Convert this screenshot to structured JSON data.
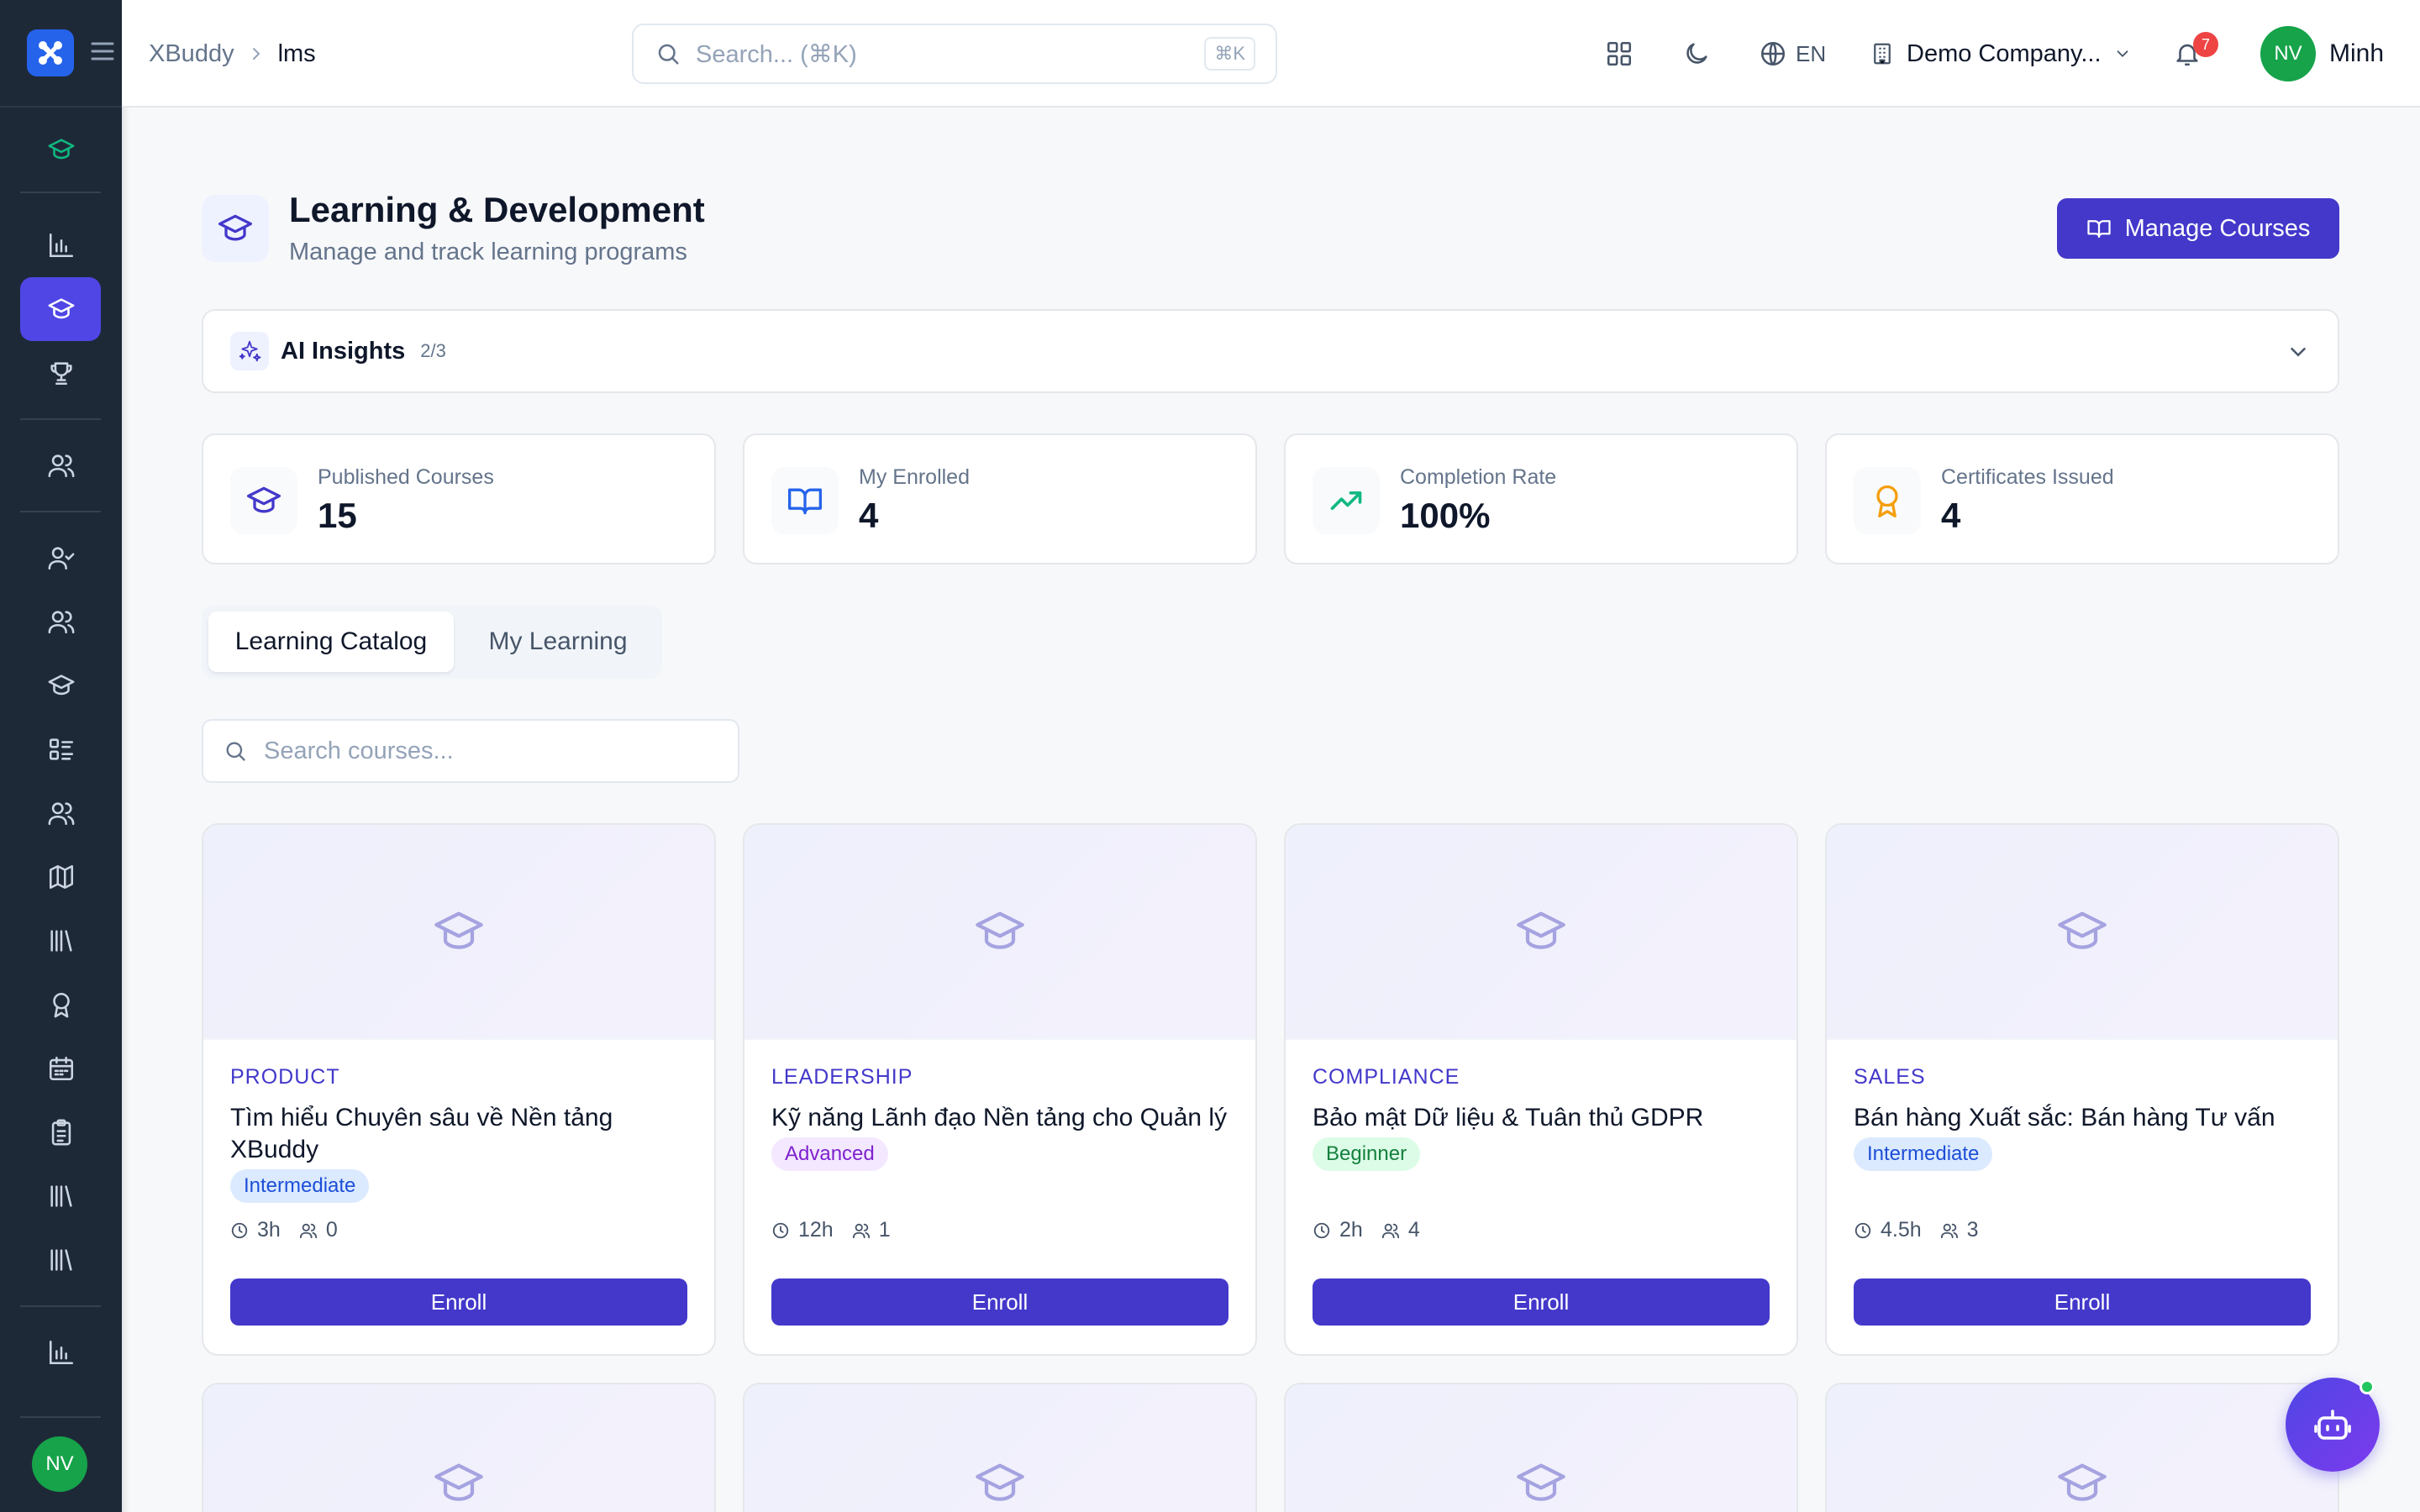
{
  "header": {
    "breadcrumb": [
      "XBuddy",
      "lms"
    ],
    "search_placeholder": "Search... (⌘K)",
    "search_shortcut": "⌘K",
    "language": "EN",
    "company": "Demo Company...",
    "notification_count": "7",
    "user_initials": "NV",
    "user_name": "Minh"
  },
  "sidebar": {
    "avatar_initials": "NV",
    "icons": [
      "graduation-cap-icon",
      "bar-chart-icon",
      "graduation-cap-icon",
      "trophy-icon",
      "users-icon",
      "user-check-icon",
      "users-icon",
      "graduation-cap-icon",
      "list-checks-icon",
      "users-icon",
      "map-icon",
      "library-icon",
      "award-icon",
      "calendar-icon",
      "clipboard-icon",
      "library-icon",
      "library-icon",
      "bar-chart-icon"
    ]
  },
  "page": {
    "title": "Learning & Development",
    "subtitle": "Manage and track learning programs",
    "manage_button": "Manage Courses"
  },
  "ai_insights": {
    "label": "AI Insights",
    "count": "2/3"
  },
  "stats": [
    {
      "label": "Published Courses",
      "value": "15",
      "icon": "graduation-cap-icon"
    },
    {
      "label": "My Enrolled",
      "value": "4",
      "icon": "book-open-icon"
    },
    {
      "label": "Completion Rate",
      "value": "100%",
      "icon": "trending-up-icon"
    },
    {
      "label": "Certificates Issued",
      "value": "4",
      "icon": "award-icon"
    }
  ],
  "tabs": [
    "Learning Catalog",
    "My Learning"
  ],
  "course_search_placeholder": "Search courses...",
  "courses": [
    {
      "category": "PRODUCT",
      "title": "Tìm hiểu Chuyên sâu về Nền tảng XBuddy",
      "level": "Intermediate",
      "duration": "3h",
      "learners": "0",
      "action": "Enroll"
    },
    {
      "category": "LEADERSHIP",
      "title": "Kỹ năng Lãnh đạo Nền tảng cho Quản lý",
      "level": "Advanced",
      "duration": "12h",
      "learners": "1",
      "action": "Enroll"
    },
    {
      "category": "COMPLIANCE",
      "title": "Bảo mật Dữ liệu & Tuân thủ GDPR",
      "level": "Beginner",
      "duration": "2h",
      "learners": "4",
      "action": "Enroll"
    },
    {
      "category": "SALES",
      "title": "Bán hàng Xuất sắc: Bán hàng Tư vấn",
      "level": "Intermediate",
      "duration": "4.5h",
      "learners": "3",
      "action": "Enroll"
    }
  ],
  "colors": {
    "sidebar": "#1e2938",
    "accent": "#4338ca",
    "active": "#4f46e5"
  }
}
